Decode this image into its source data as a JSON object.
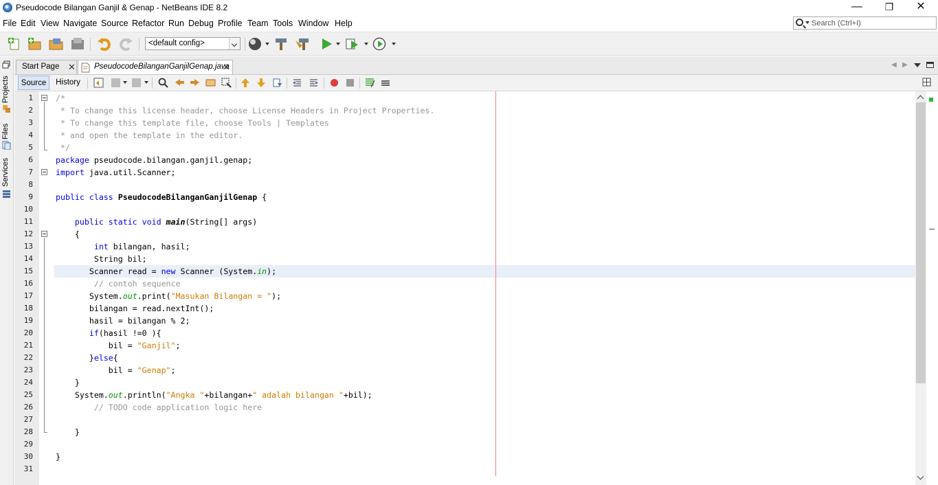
{
  "window": {
    "title": "Pseudocode Bilangan Ganjil & Genap - NetBeans IDE 8.2",
    "controls": [
      "—",
      "❐",
      "✕"
    ]
  },
  "menu": [
    "File",
    "Edit",
    "View",
    "Navigate",
    "Source",
    "Refactor",
    "Run",
    "Debug",
    "Profile",
    "Team",
    "Tools",
    "Window",
    "Help"
  ],
  "search": {
    "placeholder": "Search (Ctrl+I)"
  },
  "toolbar": {
    "config": "<default config>",
    "icons": [
      "new-file-icon",
      "new-project-icon",
      "open-project-icon",
      "close-project-icon",
      "undo-icon",
      "redo-icon",
      "globe-icon",
      "hammer-icon",
      "clean-build-icon",
      "run-icon",
      "debug-icon",
      "profile-icon"
    ]
  },
  "sidebar": {
    "tabs": [
      "Projects",
      "Files",
      "Services"
    ]
  },
  "editor_tabs": [
    {
      "label": "Start Page",
      "close": "✕"
    },
    {
      "label": "PseudocodeBilanganGanjilGenap.java",
      "close": "✕"
    }
  ],
  "editor_toolbar": {
    "source": "Source",
    "history": "History"
  },
  "code_lines": [
    {
      "n": "1",
      "t": [
        [
          "cm",
          "/*"
        ]
      ]
    },
    {
      "n": "2",
      "t": [
        [
          "cm",
          " * To change this license header, choose License Headers in Project Properties."
        ]
      ]
    },
    {
      "n": "3",
      "t": [
        [
          "cm",
          " * To change this template file, choose Tools | Templates"
        ]
      ]
    },
    {
      "n": "4",
      "t": [
        [
          "cm",
          " * and open the template in the editor."
        ]
      ]
    },
    {
      "n": "5",
      "t": [
        [
          "cm",
          " */"
        ]
      ]
    },
    {
      "n": "6",
      "t": [
        [
          "kw",
          "package"
        ],
        [
          "",
          " pseudocode.bilangan.ganjil.genap;"
        ]
      ]
    },
    {
      "n": "7",
      "t": [
        [
          "kw",
          "import"
        ],
        [
          "",
          " java.util.Scanner;"
        ]
      ]
    },
    {
      "n": "8",
      "t": []
    },
    {
      "n": "9",
      "t": [
        [
          "kw",
          "public class"
        ],
        [
          "",
          " "
        ],
        [
          "b",
          "PseudocodeBilanganGanjilGenap"
        ],
        [
          "",
          " {"
        ]
      ]
    },
    {
      "n": "10",
      "t": []
    },
    {
      "n": "11",
      "t": [
        [
          "",
          "    "
        ],
        [
          "kw",
          "public static void"
        ],
        [
          "",
          " "
        ],
        [
          "b i",
          "main"
        ],
        [
          "",
          "(String[] args)"
        ]
      ]
    },
    {
      "n": "12",
      "t": [
        [
          "",
          "    {"
        ]
      ]
    },
    {
      "n": "13",
      "t": [
        [
          "",
          "        "
        ],
        [
          "kw",
          "int"
        ],
        [
          "",
          " bilangan, hasil;"
        ]
      ]
    },
    {
      "n": "14",
      "t": [
        [
          "",
          "        String bil;"
        ]
      ]
    },
    {
      "n": "15",
      "t": [
        [
          "",
          "       Scanner read = "
        ],
        [
          "kw",
          "new"
        ],
        [
          "",
          " Scanner (System."
        ],
        [
          "fld i",
          "in"
        ],
        [
          "",
          ");"
        ]
      ]
    },
    {
      "n": "16",
      "t": [
        [
          "",
          "        "
        ],
        [
          "cm",
          "// contoh sequence"
        ]
      ]
    },
    {
      "n": "17",
      "t": [
        [
          "",
          "       System."
        ],
        [
          "fld i",
          "out"
        ],
        [
          "",
          ".print("
        ],
        [
          "str",
          "\"Masukan Bilangan = \""
        ],
        [
          "",
          ");"
        ]
      ]
    },
    {
      "n": "18",
      "t": [
        [
          "",
          "       bilangan = read.nextInt();"
        ]
      ]
    },
    {
      "n": "19",
      "t": [
        [
          "",
          "       hasil = bilangan % 2;"
        ]
      ]
    },
    {
      "n": "20",
      "t": [
        [
          "",
          "       "
        ],
        [
          "kw",
          "if"
        ],
        [
          "",
          "(hasil !=0 ){"
        ]
      ]
    },
    {
      "n": "21",
      "t": [
        [
          "",
          "           bil = "
        ],
        [
          "str",
          "\"Ganjil\""
        ],
        [
          "",
          ";"
        ]
      ]
    },
    {
      "n": "22",
      "t": [
        [
          "",
          "       }"
        ],
        [
          "kw",
          "else"
        ],
        [
          "",
          "{"
        ]
      ]
    },
    {
      "n": "23",
      "t": [
        [
          "",
          "           bil = "
        ],
        [
          "str",
          "\"Genap\""
        ],
        [
          "",
          ";"
        ]
      ]
    },
    {
      "n": "24",
      "t": [
        [
          "",
          "    }"
        ]
      ]
    },
    {
      "n": "25",
      "t": [
        [
          "",
          "    System."
        ],
        [
          "fld i",
          "out"
        ],
        [
          "",
          ".println("
        ],
        [
          "str",
          "\"Angka \""
        ],
        [
          "",
          "+bilangan+"
        ],
        [
          "str",
          "\" adalah bilangan \""
        ],
        [
          "",
          "+bil);"
        ]
      ]
    },
    {
      "n": "26",
      "t": [
        [
          "",
          "        "
        ],
        [
          "cm",
          "// TODO code application logic here"
        ]
      ]
    },
    {
      "n": "27",
      "t": []
    },
    {
      "n": "28",
      "t": [
        [
          "",
          "    }"
        ]
      ]
    },
    {
      "n": "29",
      "t": []
    },
    {
      "n": "30",
      "t": [
        [
          "",
          "}"
        ]
      ]
    },
    {
      "n": "31",
      "t": []
    }
  ],
  "highlighted_line": "15"
}
